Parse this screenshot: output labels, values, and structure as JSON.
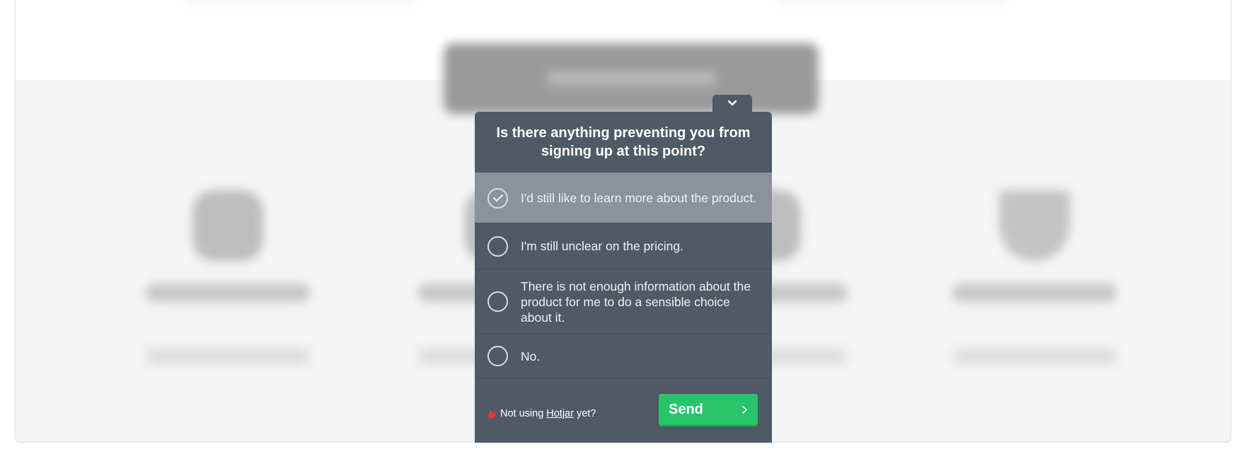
{
  "survey": {
    "question": "Is there anything preventing you from signing up at this point?",
    "options": [
      {
        "label": "I'd still like to learn more about the product.",
        "selected": true
      },
      {
        "label": "I'm still unclear on the pricing.",
        "selected": false
      },
      {
        "label": "There is not enough information about the product for me to do a sensible choice about it.",
        "selected": false
      },
      {
        "label": "No.",
        "selected": false
      }
    ],
    "footer": {
      "prefix": "Not using",
      "link": "Hotjar",
      "suffix": "yet?"
    },
    "send_label": "Send",
    "icons": {
      "collapse": "chevron-down-icon",
      "selected": "check-icon",
      "brand": "hotjar-logo-icon",
      "send": "chevron-right-icon"
    }
  },
  "colors": {
    "widget_bg": "#4f5a65",
    "selected_bg": "#8a929b",
    "send_button": "#27c46b",
    "brand_logo": "#e23b3b"
  }
}
